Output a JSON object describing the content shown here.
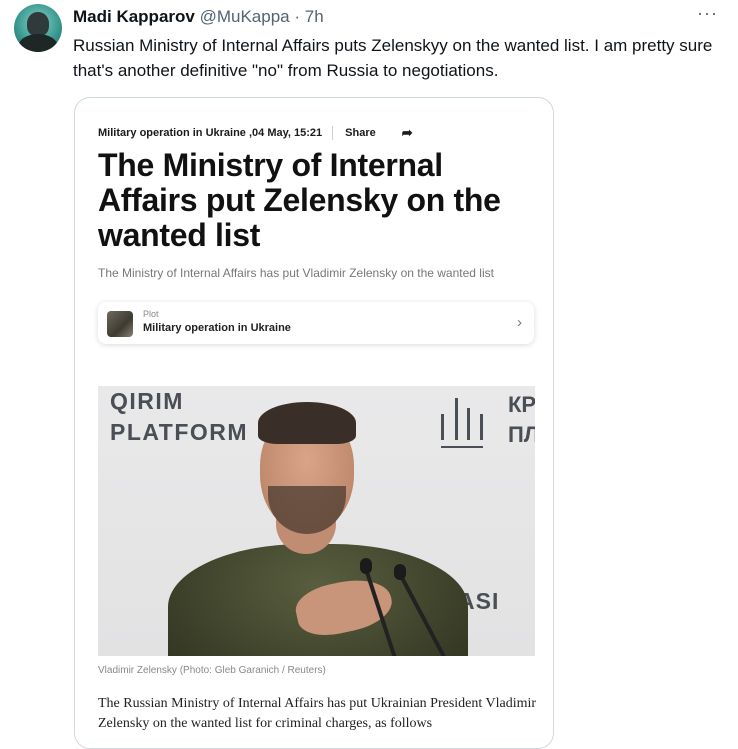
{
  "tweet": {
    "author_name": "Madi Kapparov",
    "handle": "@MuKappa",
    "separator": "·",
    "time": "7h",
    "more_label": "···",
    "text": "Russian Ministry of Internal Affairs puts Zelenskyy on the wanted list. I am pretty sure that's another definitive \"no\" from Russia to negotiations."
  },
  "card": {
    "category": "Military operation in Ukraine ,04 May, 15:21",
    "share_label": "Share",
    "share_icon": "➦",
    "headline": "The Ministry of Internal Affairs put Zelensky on the wanted list",
    "subtitle": "The Ministry of Internal Affairs has put Vladimir Zelensky on the wanted list",
    "plot": {
      "kicker": "Plot",
      "title": "Military operation in Ukraine",
      "chevron": "›"
    },
    "photo": {
      "backdrop_line1": "QIRIM",
      "backdrop_line2": "PLATFORM",
      "backdrop_right_line1": "КР",
      "backdrop_right_line2": "ПЛ",
      "backdrop_bottom": "ASI"
    },
    "caption": "Vladimir Zelensky (Photo: Gleb Garanich / Reuters)",
    "body": "The Russian Ministry of Internal Affairs has put Ukrainian President Vladimir Zelensky on the wanted list for criminal charges, as follows"
  }
}
